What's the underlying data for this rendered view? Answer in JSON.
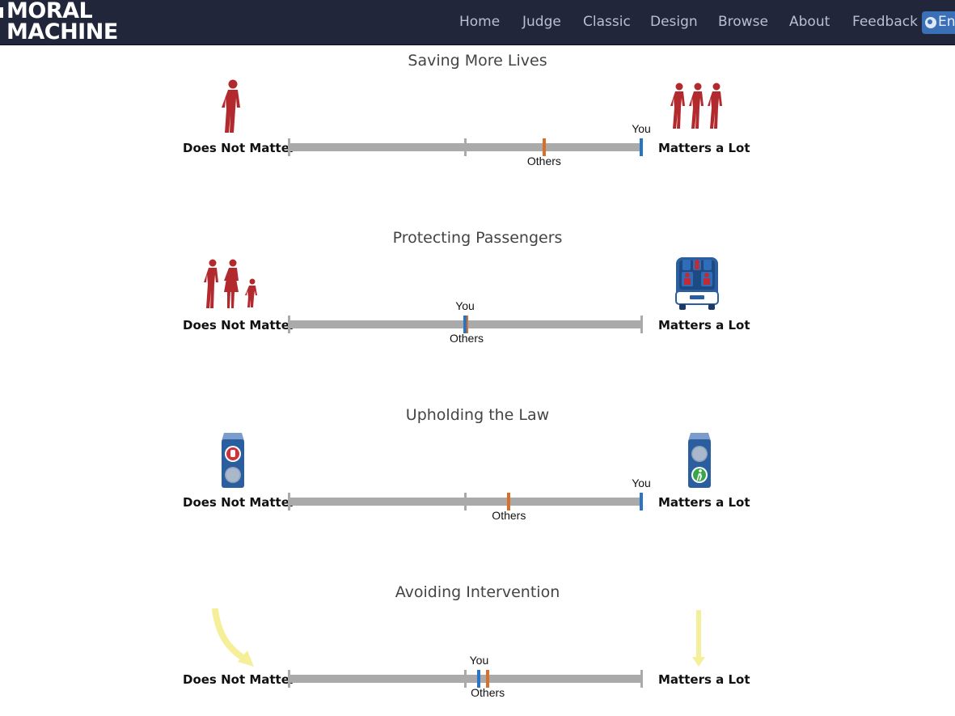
{
  "nav": {
    "logo_line1": "MORAL",
    "logo_line2": "MACHINE",
    "items": [
      "Home",
      "Judge",
      "Classic",
      "Design",
      "Browse",
      "About",
      "Feedback"
    ],
    "language": "En"
  },
  "scale": {
    "left_label": "Does Not Matter",
    "right_label": "Matters a Lot"
  },
  "markers": {
    "you": "You",
    "others": "Others"
  },
  "colors": {
    "you": "#2a74c5",
    "others": "#d8702c",
    "track": "#aaaaaa",
    "figure": "#b22a2e",
    "arrow": "#f6ef9a"
  },
  "sections": [
    {
      "title": "Saving More Lives",
      "you": 1.0,
      "others": 0.72,
      "left_icon": "single-pedestrian-icon",
      "right_icon": "three-pedestrians-icon"
    },
    {
      "title": "Protecting Passengers",
      "you": 0.5,
      "others": 0.5,
      "left_icon": "family-pedestrians-icon",
      "right_icon": "car-with-passengers-icon"
    },
    {
      "title": "Upholding the Law",
      "you": 1.0,
      "others": 0.62,
      "left_icon": "red-hand-traffic-light-icon",
      "right_icon": "green-walk-traffic-light-icon"
    },
    {
      "title": "Avoiding Intervention",
      "you": 0.54,
      "others": 0.56,
      "left_icon": "swerving-arrow-icon",
      "right_icon": "straight-arrow-icon"
    }
  ]
}
